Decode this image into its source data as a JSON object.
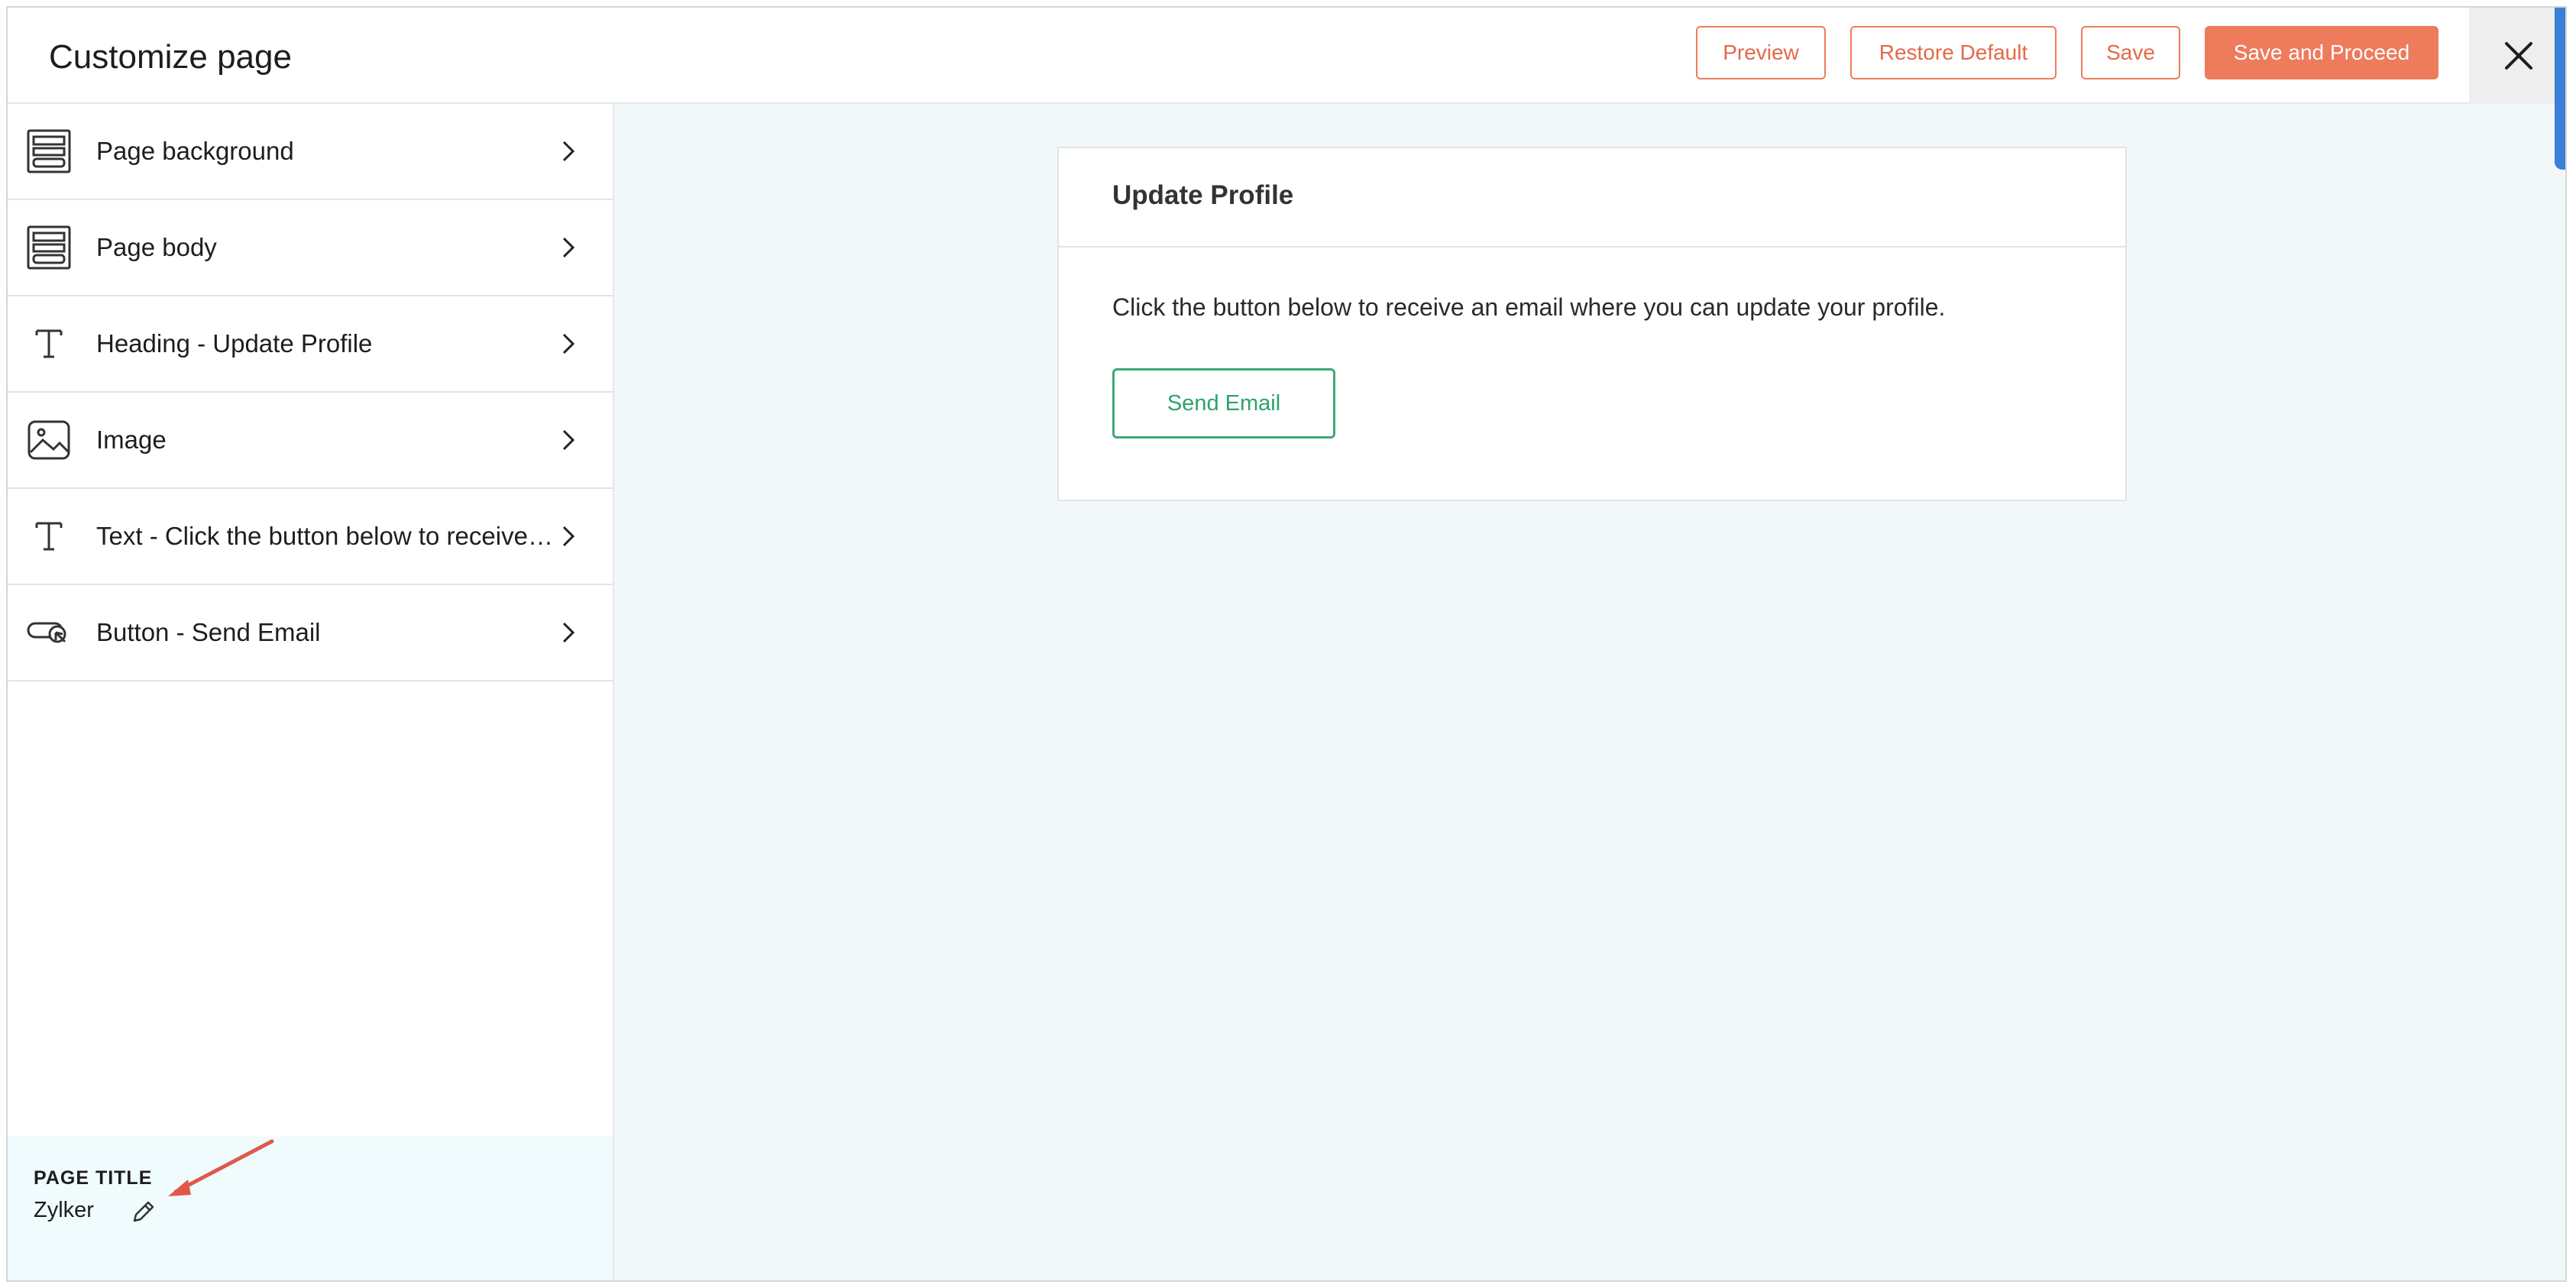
{
  "header": {
    "title": "Customize page",
    "buttons": {
      "preview": "Preview",
      "restore_default": "Restore Default",
      "save": "Save",
      "save_and_proceed": "Save and Proceed"
    },
    "accent_color": "#ee7b5c"
  },
  "sidebar": {
    "items": [
      {
        "label": "Page background",
        "icon": "layout-icon"
      },
      {
        "label": "Page body",
        "icon": "layout-icon"
      },
      {
        "label": "Heading - Update Profile",
        "icon": "text-icon"
      },
      {
        "label": "Image",
        "icon": "image-icon"
      },
      {
        "label": "Text - Click the button below to receive an email where you can update your profile.",
        "icon": "text-icon"
      },
      {
        "label": "Button - Send Email",
        "icon": "button-click-icon"
      }
    ],
    "footer": {
      "label": "PAGE TITLE",
      "value": "Zylker"
    }
  },
  "preview": {
    "heading": "Update Profile",
    "text": "Click the button below to receive an email where you can update your profile.",
    "button_label": "Send Email",
    "button_color": "#3daa76"
  }
}
